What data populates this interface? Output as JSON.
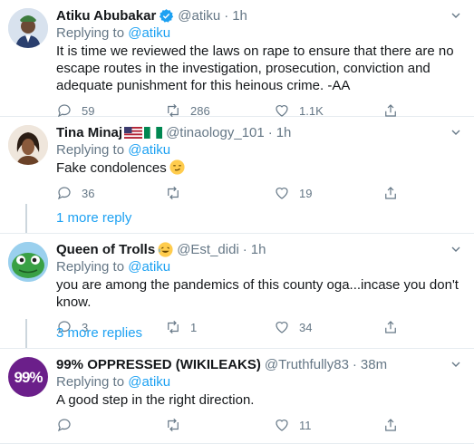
{
  "tweets": [
    {
      "name": "Atiku Abubakar",
      "handle": "@atiku",
      "time": "1h",
      "replying_label": "Replying to",
      "replying_handle": "@atiku",
      "text": "It is time we reviewed the laws on rape to ensure that there are no escape routes in the investigation, prosecution, conviction and adequate punishment for this heinous crime. -AA",
      "replies": "59",
      "retweets": "286",
      "likes": "1.1K"
    },
    {
      "name": "Tina Minaj",
      "handle": "@tinaology_101",
      "time": "1h",
      "replying_label": "Replying to",
      "replying_handle": "@atiku",
      "text": "Fake condolences",
      "replies": "36",
      "retweets": "",
      "likes": "19",
      "more_replies": "1 more reply"
    },
    {
      "name": "Queen of Trolls",
      "handle": "@Est_didi",
      "time": "1h",
      "replying_label": "Replying to",
      "replying_handle": "@atiku",
      "text": "you are among the pandemics of this county oga...incase you don't know.",
      "replies": "3",
      "retweets": "1",
      "likes": "34",
      "more_replies": "3 more replies"
    },
    {
      "name": "99% OPPRESSED (WIKILEAKS)",
      "handle": "@Truthfully83",
      "time": "38m",
      "replying_label": "Replying to",
      "replying_handle": "@atiku",
      "text": "A good step in the right direction.",
      "replies": "",
      "retweets": "",
      "likes": "11",
      "avatar_text": "99%"
    }
  ],
  "separator": "·",
  "colors": {
    "link": "#1da1f2",
    "muted": "#657786",
    "border": "#e6ecf0",
    "verified": "#1da1f2"
  }
}
